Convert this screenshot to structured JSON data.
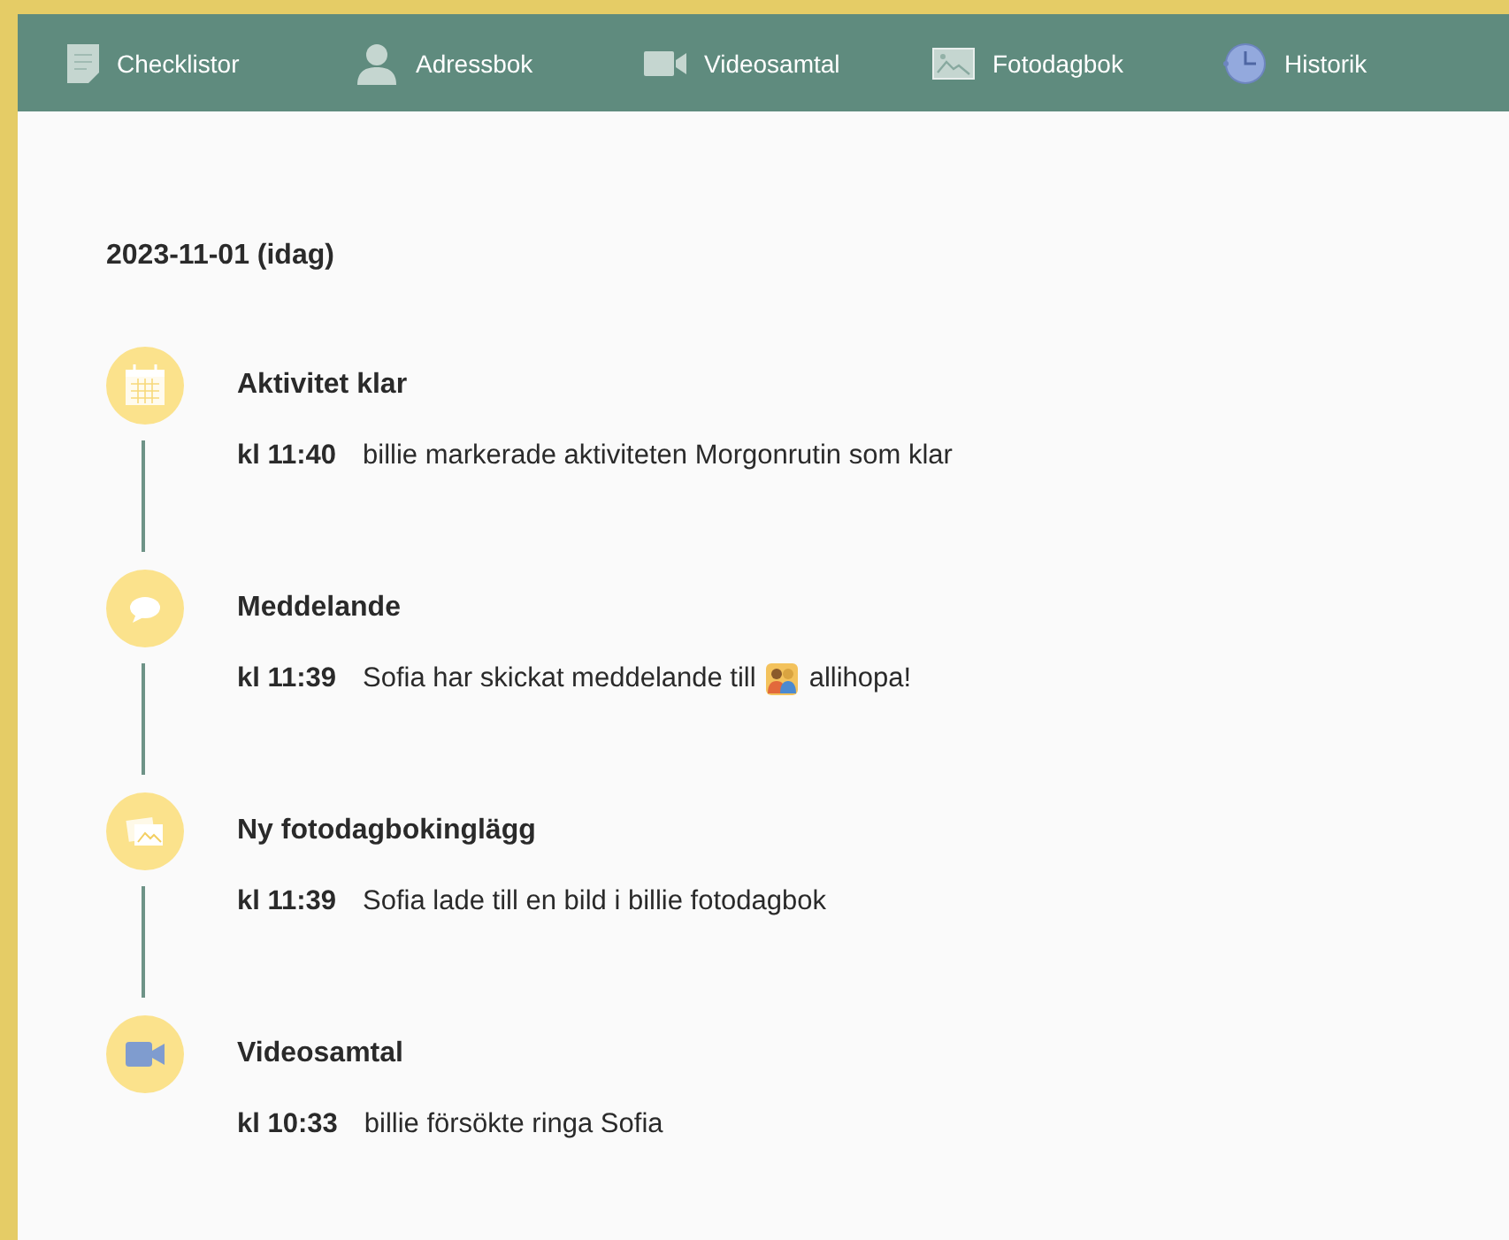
{
  "nav": [
    {
      "kind": "checklist",
      "label": "Checklistor",
      "selected": false
    },
    {
      "kind": "contacts",
      "label": "Adressbok",
      "selected": false
    },
    {
      "kind": "video",
      "label": "Videosamtal",
      "selected": false
    },
    {
      "kind": "photo",
      "label": "Fotodagbok",
      "selected": false
    },
    {
      "kind": "history",
      "label": "Historik",
      "selected": true
    }
  ],
  "date_heading": "2023-11-01 (idag)",
  "events": [
    {
      "kind": "activity",
      "title": "Aktivitet klar",
      "time": "kl 11:40",
      "text": "billie markerade aktiviteten Morgonrutin som klar"
    },
    {
      "kind": "message",
      "title": "Meddelande",
      "time": "kl 11:39",
      "text": "Sofia har skickat meddelande till",
      "parts": [
        {
          "kind": "group_icon"
        },
        {
          "kind": "text",
          "text": "allihopa!"
        }
      ]
    },
    {
      "kind": "photo",
      "title": "Ny fotodagbokinglägg",
      "time": "kl 11:39",
      "text": "Sofia lade till en bild i billie fotodagbok"
    },
    {
      "kind": "video",
      "title": "Videosamtal",
      "time": "kl 10:33",
      "text": "billie försökte ringa Sofia"
    }
  ]
}
